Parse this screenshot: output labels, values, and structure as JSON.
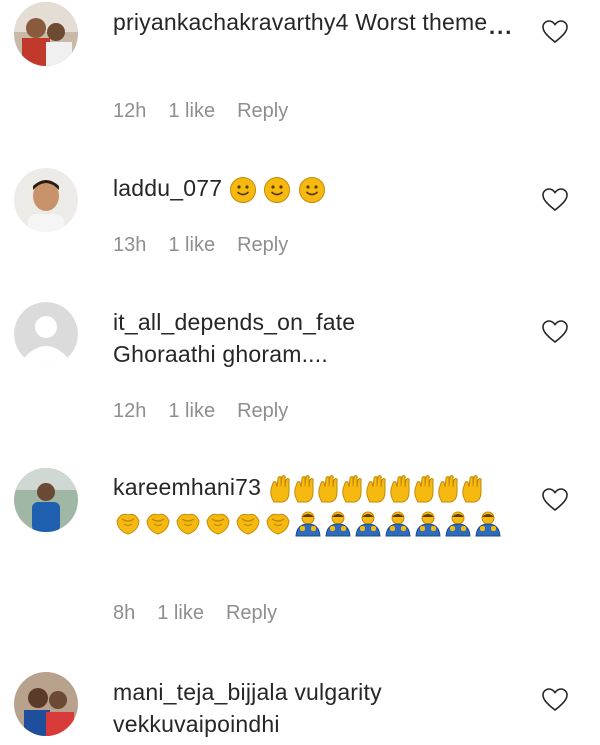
{
  "comments": [
    {
      "username": "priyankachakravarthy4",
      "text": "Worst theme",
      "time": "12h",
      "likes": "1 like",
      "reply": "Reply",
      "avatar": "avatar-photo-couple"
    },
    {
      "username": "laddu_077",
      "text": "",
      "emojis": [
        "smiling-face-icon",
        "smiling-face-icon",
        "smiling-face-icon"
      ],
      "time": "13h",
      "likes": "1 like",
      "reply": "Reply",
      "avatar": "avatar-photo-man"
    },
    {
      "username": "it_all_depends_on_fate",
      "text": "Ghoraathi ghoram....",
      "time": "12h",
      "likes": "1 like",
      "reply": "Reply",
      "avatar": "avatar-default"
    },
    {
      "username": "kareemhani73",
      "text": "",
      "emojis": [
        "thumbs-icon",
        "clapping-hands-icon",
        "bowing-person-icon"
      ],
      "time": "8h",
      "likes": "1 like",
      "reply": "Reply",
      "avatar": "avatar-photo-person-blue"
    },
    {
      "username": "mani_teja_bijjala",
      "text": "vulgarity vekkuvaipoindhi",
      "avatar": "avatar-photo-couple-red"
    }
  ],
  "more_options_label": "...",
  "colors": {
    "text": "#262626",
    "meta": "#8e8e8e",
    "emoji_yellow": "#f5b90f",
    "emoji_blue": "#2d6bbd"
  }
}
